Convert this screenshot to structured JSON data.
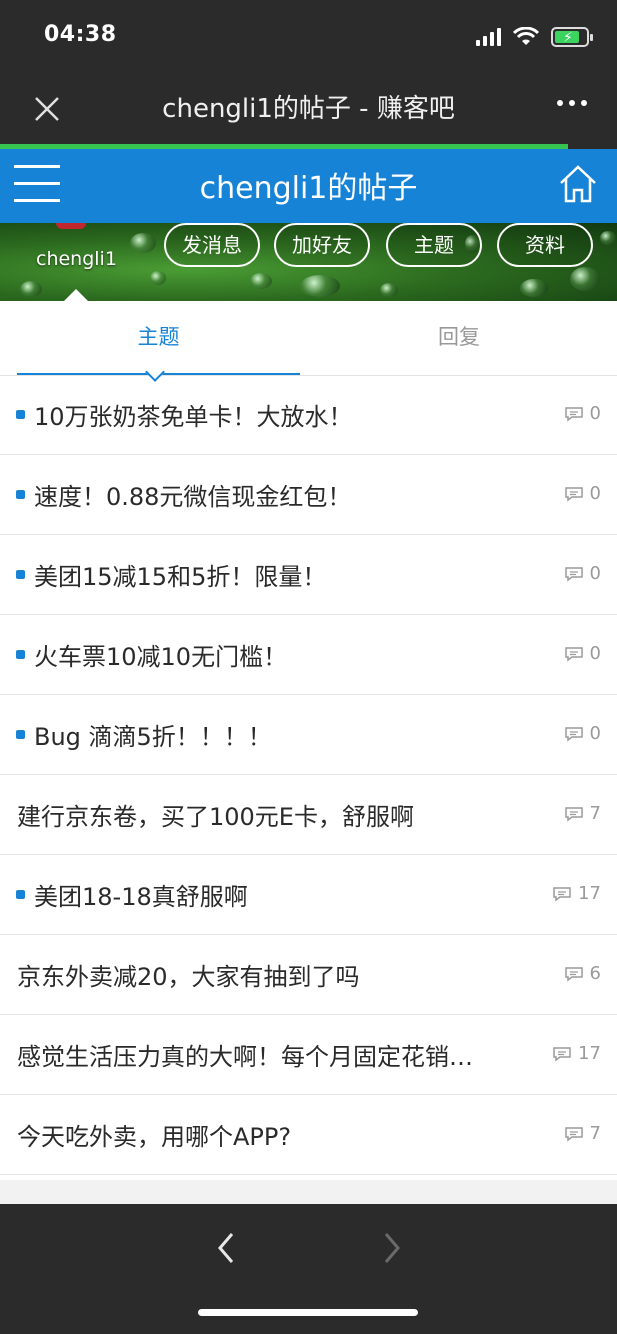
{
  "status": {
    "time": "04:38"
  },
  "webview": {
    "title": "chengli1的帖子 - 赚客吧"
  },
  "header": {
    "title": "chengli1的帖子"
  },
  "profile": {
    "username": "chengli1",
    "buttons": [
      "发消息",
      "加好友",
      "主题",
      "资料"
    ]
  },
  "tabs": {
    "active": "主题",
    "inactive": "回复"
  },
  "posts": [
    {
      "title": "10万张奶茶免单卡！大放水！",
      "comments": "0",
      "dot": true
    },
    {
      "title": "速度！0.88元微信现金红包！",
      "comments": "0",
      "dot": true
    },
    {
      "title": "美团15减15和5折！限量！",
      "comments": "0",
      "dot": true
    },
    {
      "title": "火车票10减10无门槛！",
      "comments": "0",
      "dot": true
    },
    {
      "title": "Bug 滴滴5折！！！！",
      "comments": "0",
      "dot": true
    },
    {
      "title": "建行京东卷，买了100元E卡，舒服啊",
      "comments": "7",
      "dot": false
    },
    {
      "title": "美团18-18真舒服啊",
      "comments": "17",
      "dot": true
    },
    {
      "title": "京东外卖减20，大家有抽到了吗",
      "comments": "6",
      "dot": false
    },
    {
      "title": "感觉生活压力真的大啊！每个月固定花销…",
      "comments": "17",
      "dot": false
    },
    {
      "title": "今天吃外卖，用哪个APP?",
      "comments": "7",
      "dot": false
    }
  ],
  "colors": {
    "accent": "#1683d6",
    "progress": "#38c450",
    "chrome": "#2b2b2b"
  },
  "icons": [
    "signal-icon",
    "wifi-icon",
    "battery-icon",
    "close-icon",
    "more-icon",
    "menu-icon",
    "home-icon",
    "comment-icon",
    "back-icon",
    "forward-icon"
  ]
}
